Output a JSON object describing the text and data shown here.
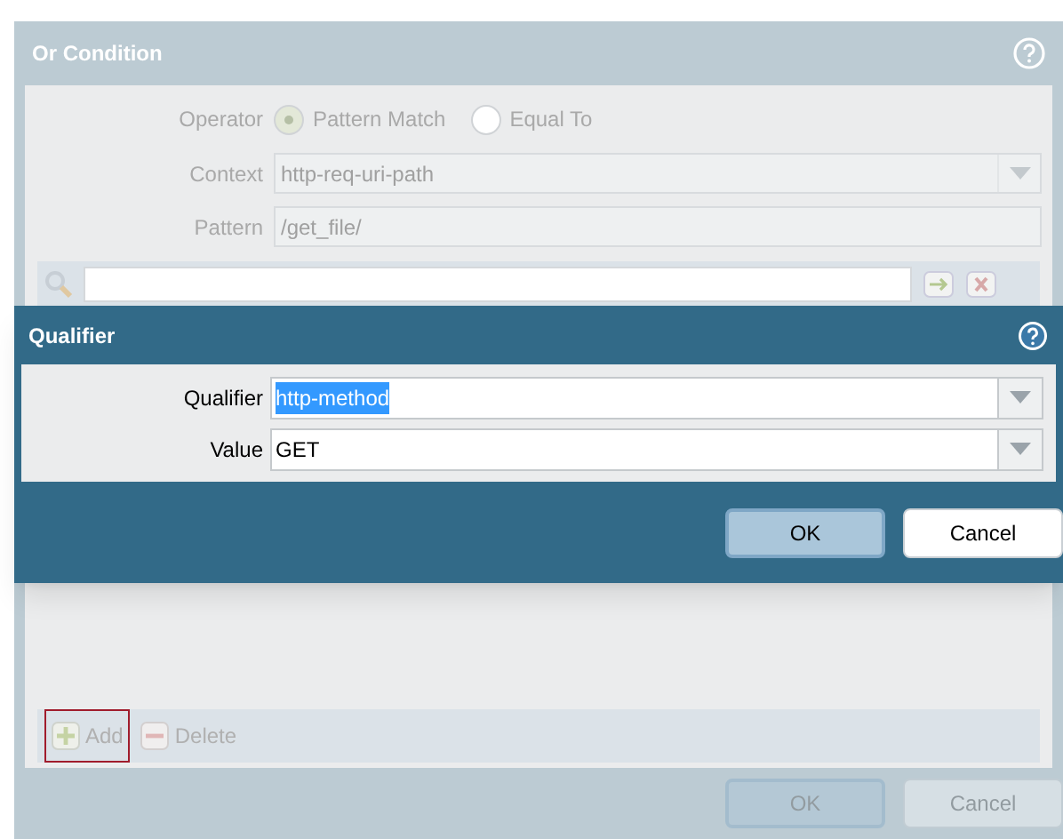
{
  "or_condition": {
    "title": "Or Condition",
    "operator": {
      "label": "Operator",
      "options": [
        {
          "label": "Pattern Match",
          "selected": true
        },
        {
          "label": "Equal To",
          "selected": false
        }
      ]
    },
    "fields": [
      {
        "label": "Context",
        "value": "http-req-uri-path",
        "kind": "dropdown"
      },
      {
        "label": "Pattern",
        "value": "/get_file/",
        "kind": "text"
      }
    ],
    "toolbar": [
      {
        "label": "Add",
        "kind": "add",
        "highlighted": true
      },
      {
        "label": "Delete",
        "kind": "delete",
        "highlighted": false
      }
    ],
    "buttons": [
      {
        "label": "OK",
        "kind": "primary"
      },
      {
        "label": "Cancel",
        "kind": "secondary"
      }
    ]
  },
  "qualifier_dialog": {
    "title": "Qualifier",
    "fields": [
      {
        "label": "Qualifier",
        "value": "http-method",
        "text_selected": true
      },
      {
        "label": "Value",
        "value": "GET",
        "text_selected": false
      }
    ],
    "buttons": [
      {
        "label": "OK",
        "kind": "primary"
      },
      {
        "label": "Cancel",
        "kind": "secondary"
      }
    ]
  }
}
